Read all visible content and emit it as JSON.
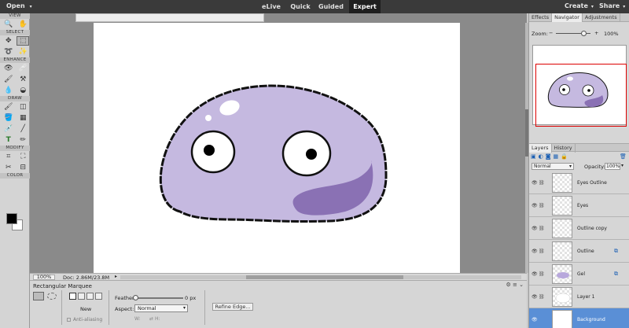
{
  "menubar": {
    "open_label": "Open",
    "modes": [
      "eLive",
      "Quick",
      "Guided",
      "Expert"
    ],
    "active_mode": "Expert",
    "create_label": "Create",
    "share_label": "Share"
  },
  "tools": {
    "sections": [
      "VIEW",
      "SELECT",
      "ENHANCE",
      "DRAW",
      "MODIFY",
      "COLOR"
    ],
    "foreground_color": "#000000",
    "background_color": "#ffffff"
  },
  "status": {
    "zoom": "100%",
    "doc_info": "Doc: 2.86M/23.8M"
  },
  "options": {
    "tool_name": "Rectangular Marquee",
    "mode_label": "New",
    "anti_alias_label": "Anti-aliasing",
    "feather_label": "Feather:",
    "feather_value": "0 px",
    "aspect_label": "Aspect:",
    "aspect_value": "Normal",
    "w_label": "W:",
    "h_label": "H:",
    "refine_label": "Refine Edge..."
  },
  "panels": {
    "tabs": [
      "Effects",
      "Navigator",
      "Adjustments"
    ],
    "active_tab": "Navigator",
    "zoom_label": "Zoom:",
    "zoom_value": "100%",
    "layer_tabs": [
      "Layers",
      "History"
    ],
    "blend_mode": "Normal",
    "opacity_label": "Opacity:",
    "opacity_value": "100%",
    "layers": [
      {
        "name": "Eyes Outline",
        "selected": false,
        "mask": false
      },
      {
        "name": "Eyes",
        "selected": false,
        "mask": false
      },
      {
        "name": "Outline copy",
        "selected": false,
        "mask": false
      },
      {
        "name": "Outline",
        "selected": false,
        "mask": true
      },
      {
        "name": "Gel",
        "selected": false,
        "mask": true
      },
      {
        "name": "Layer 1",
        "selected": false,
        "mask": false
      },
      {
        "name": "Background",
        "selected": true,
        "mask": false
      }
    ]
  },
  "artwork": {
    "blob_fill": "#c5b9e0",
    "mouth_fill": "#8a71b4",
    "outline": "#111111"
  }
}
